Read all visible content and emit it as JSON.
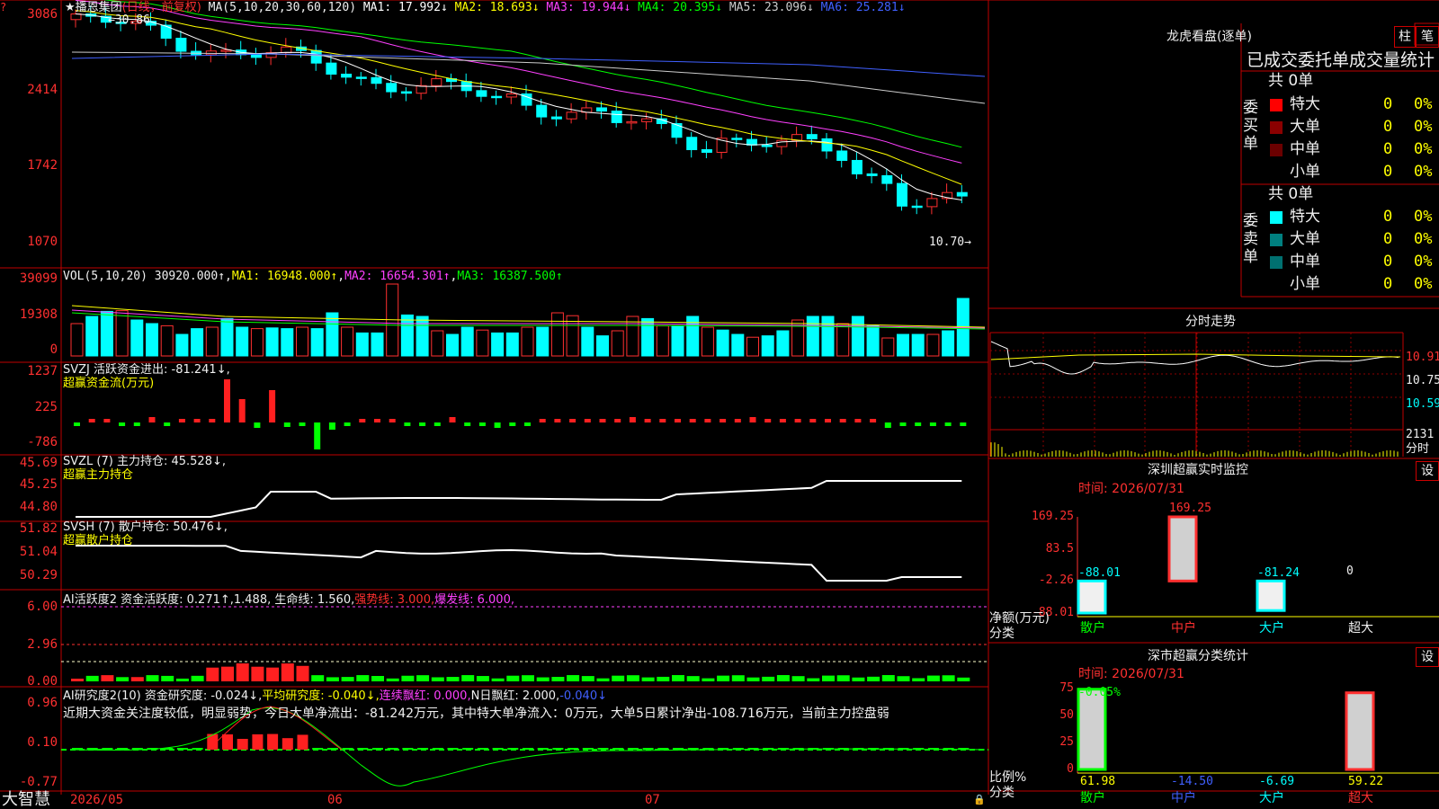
{
  "stock": {
    "name": "播恩集团",
    "mode": "(日线，前复权)",
    "ma_prefix": "MA(5,10,20,30,60,120)"
  },
  "main_ma": [
    {
      "label": "MA1:",
      "value": "17.992↓",
      "color": "#ffffff"
    },
    {
      "label": "MA2:",
      "value": "18.693↓",
      "color": "#ffff00"
    },
    {
      "label": "MA3:",
      "value": "19.944↓",
      "color": "#ff40ff"
    },
    {
      "label": "MA4:",
      "value": "20.395↓",
      "color": "#00ff00"
    },
    {
      "label": "MA5:",
      "value": "23.096↓",
      "color": "#cccccc"
    },
    {
      "label": "MA6:",
      "value": "25.281↓",
      "color": "#4060ff"
    }
  ],
  "main_axis": [
    "3086",
    "2414",
    "1742",
    "1070"
  ],
  "main_notes": {
    "high": "30.86",
    "low": "10.70"
  },
  "vol": {
    "title": "VOL(5,10,20)",
    "value": "30920.000↑",
    "ma1": "MA1: 16948.000↑",
    "ma2": "MA2: 16654.301↑",
    "ma3": "MA3: 16387.500↑",
    "axis": [
      "39099",
      "19308",
      "0"
    ]
  },
  "svzj": {
    "title": "SVZJ  活跃资金进出: -81.241↓,",
    "sub": "超赢资金流(万元)",
    "axis": [
      "1237",
      "225",
      "-786"
    ]
  },
  "svzl": {
    "title": "SVZL (7) 主力持仓: 45.528↓,",
    "sub": "超赢主力持仓",
    "axis": [
      "45.69",
      "45.25",
      "44.80"
    ]
  },
  "svsh": {
    "title": "SVSH (7) 散户持仓: 50.476↓,",
    "sub": "超赢散户持仓",
    "axis": [
      "51.82",
      "51.04",
      "50.29"
    ]
  },
  "ai1": {
    "title": "AI活跃度2 资金活跃度: 0.271↑,1.488, 生命线: 1.560,",
    "strong": "强势线: 3.000,",
    "burst": "爆发线: 6.000,",
    "axis": [
      "6.00",
      "2.96",
      "0.00"
    ]
  },
  "ai2": {
    "title": "AI研究度2(10) 资金研究度: -0.024↓,",
    "avg": "平均研究度: -0.040↓,",
    "red": "连续飘红: 0.000,",
    "nred": "N日飘红: 2.000,",
    "last": "-0.040↓",
    "comment": "近期大资金关注度较低，明显弱势，今日大单净流出：-81.242万元，其中特大单净流入：0万元，大单5日累计净出-108.716万元，当前主力控盘弱",
    "axis": [
      "0.96",
      "0.10",
      "-0.77"
    ]
  },
  "dates": [
    "2026/05",
    "06",
    "07"
  ],
  "brand": "大智慧",
  "lhb": {
    "title": "龙虎看盘(逐单)",
    "btn1": "柱",
    "btn2": "笔",
    "tabs": "已成交委托单成交量统计",
    "buy_label": "委买单",
    "sell_label": "委卖单",
    "buy_total": "共 0单",
    "sell_total": "共 0单",
    "buy_rows": [
      {
        "name": "特大",
        "v": "0",
        "p": "0%",
        "c": "#ff0000"
      },
      {
        "name": "大单",
        "v": "0",
        "p": "0%",
        "c": "#8b0000"
      },
      {
        "name": "中单",
        "v": "0",
        "p": "0%",
        "c": "#6b0000"
      },
      {
        "name": "小单",
        "v": "0",
        "p": "0%",
        "c": ""
      }
    ],
    "sell_rows": [
      {
        "name": "特大",
        "v": "0",
        "p": "0%",
        "c": "#00ffff"
      },
      {
        "name": "大单",
        "v": "0",
        "p": "0%",
        "c": "#008080"
      },
      {
        "name": "中单",
        "v": "0",
        "p": "0%",
        "c": "#007070"
      },
      {
        "name": "小单",
        "v": "0",
        "p": "0%",
        "c": ""
      }
    ]
  },
  "intraday": {
    "title": "分时走势",
    "axis": [
      "10.91",
      "10.75",
      "10.59"
    ],
    "vol": "2131",
    "vol_label": "分时"
  },
  "sz_monitor": {
    "title": "深圳超赢实时监控",
    "btn": "设",
    "time": "时间: 2026/07/31",
    "axis": [
      "169.25",
      "83.5",
      "-2.26",
      "-88.01"
    ],
    "ylabel": "净额(万元)",
    "xlabel": "分类",
    "categories": [
      "散户",
      "中户",
      "大户",
      "超大"
    ],
    "values": [
      "-88.01",
      "169.25",
      "-81.24",
      "0"
    ],
    "values_num": [
      -88.01,
      169.25,
      -81.24,
      0
    ]
  },
  "sz_stats": {
    "title": "深市超赢分类统计",
    "btn": "设",
    "time": "时间: 2026/07/31",
    "axis": [
      "75",
      "50",
      "25",
      "0"
    ],
    "ylabel": "比例%",
    "xlabel": "分类",
    "top_label": "-0.05%",
    "categories": [
      "散户",
      "中户",
      "大户",
      "超大"
    ],
    "values": [
      "61.98",
      "-14.50",
      "-6.69",
      "59.22"
    ],
    "values_num": [
      61.98,
      -14.5,
      -6.69,
      59.22
    ]
  },
  "chart_data": [
    {
      "type": "bar",
      "title": "深圳超赢实时监控",
      "xlabel": "分类",
      "ylabel": "净额(万元)",
      "categories": [
        "散户",
        "中户",
        "大户",
        "超大"
      ],
      "values": [
        -88.01,
        169.25,
        -81.24,
        0
      ],
      "ylim": [
        -88.01,
        169.25
      ]
    },
    {
      "type": "bar",
      "title": "深市超赢分类统计",
      "xlabel": "分类",
      "ylabel": "比例%",
      "categories": [
        "散户",
        "中户",
        "大户",
        "超大"
      ],
      "values": [
        61.98,
        -14.5,
        -6.69,
        59.22
      ],
      "ylim": [
        0,
        75
      ]
    }
  ]
}
